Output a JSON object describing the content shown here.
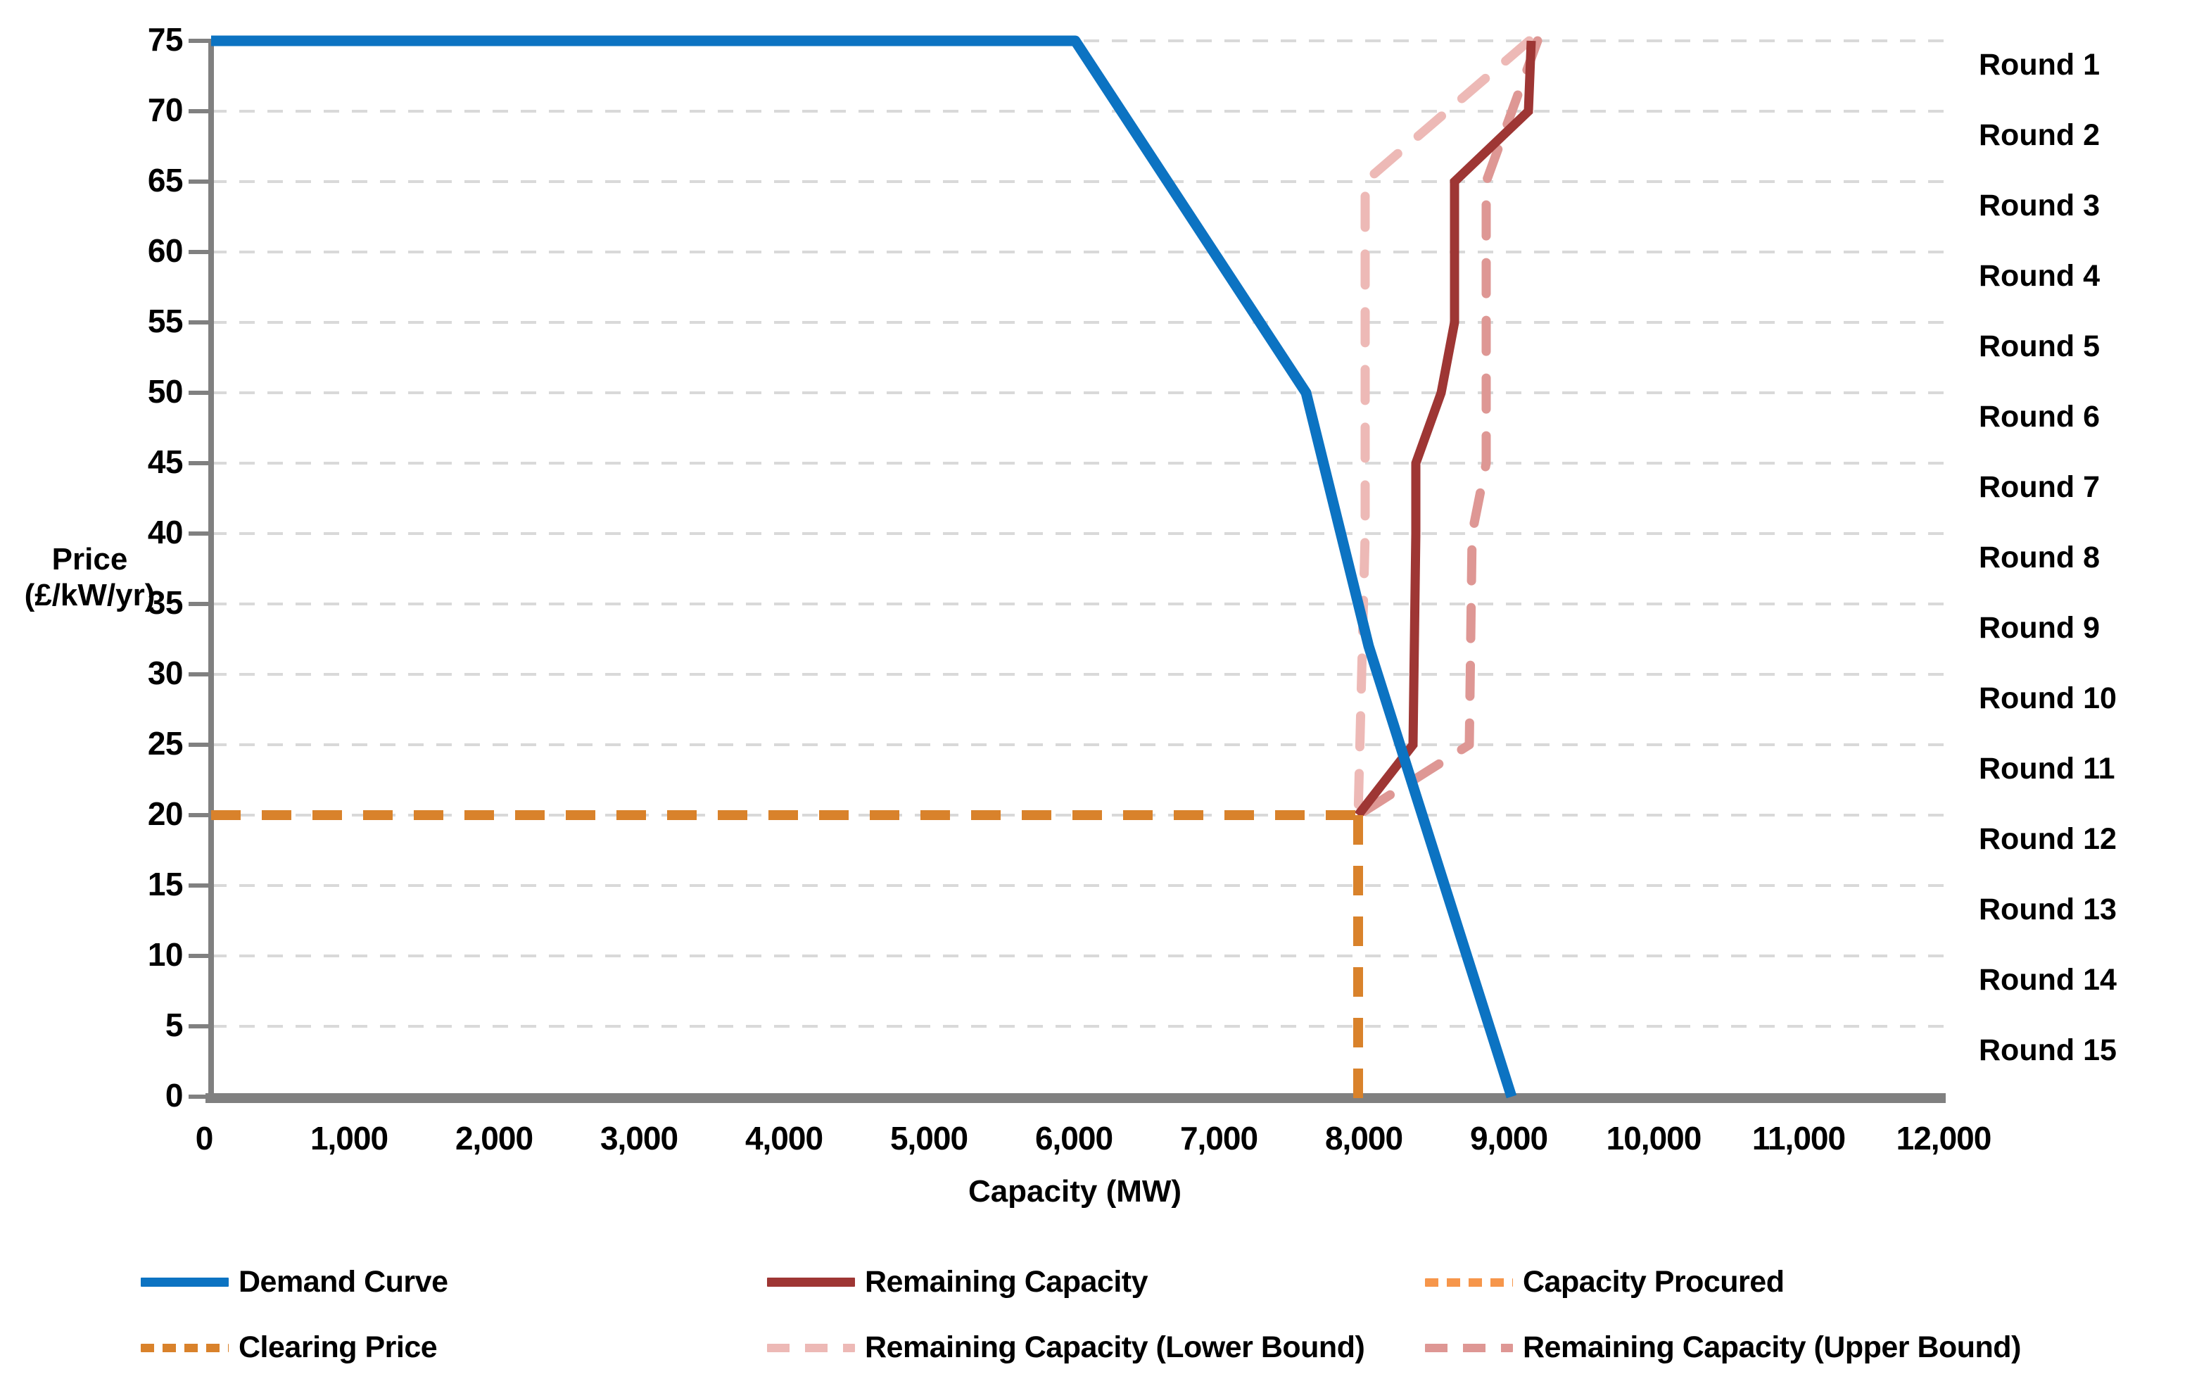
{
  "axes": {
    "y_title": "Price\n(£/kW/yr)",
    "y_title_line1": "Price",
    "y_title_line2": "(£/kW/yr)",
    "x_title": "Capacity (MW)",
    "y_ticks": [
      "0",
      "5",
      "10",
      "15",
      "20",
      "25",
      "30",
      "35",
      "40",
      "45",
      "50",
      "55",
      "60",
      "65",
      "70",
      "75"
    ],
    "x_ticks": [
      "0",
      "1,000",
      "2,000",
      "3,000",
      "4,000",
      "5,000",
      "6,000",
      "7,000",
      "8,000",
      "9,000",
      "10,000",
      "11,000",
      "12,000"
    ]
  },
  "rounds": [
    {
      "label": "Round 1"
    },
    {
      "label": "Round 2"
    },
    {
      "label": "Round 3"
    },
    {
      "label": "Round 4"
    },
    {
      "label": "Round 5"
    },
    {
      "label": "Round 6"
    },
    {
      "label": "Round 7"
    },
    {
      "label": "Round 8"
    },
    {
      "label": "Round 9"
    },
    {
      "label": "Round 10"
    },
    {
      "label": "Round 11"
    },
    {
      "label": "Round 12"
    },
    {
      "label": "Round 13"
    },
    {
      "label": "Round 14"
    },
    {
      "label": "Round 15"
    }
  ],
  "legend": [
    {
      "label": "Demand Curve",
      "color": "#0C73C2",
      "style": "solid"
    },
    {
      "label": "Remaining Capacity",
      "color": "#9E3634",
      "style": "solid"
    },
    {
      "label": "Capacity Procured",
      "color": "#F6964B",
      "style": "dotted"
    },
    {
      "label": "Clearing Price",
      "color": "#D9822B",
      "style": "dotted"
    },
    {
      "label": "Remaining Capacity (Lower Bound)",
      "color": "#EDB9B6",
      "style": "dashed"
    },
    {
      "label": "Remaining Capacity (Upper Bound)",
      "color": "#DE9794",
      "style": "dashed"
    }
  ],
  "colors": {
    "demand": "#0C73C2",
    "remaining": "#9E3634",
    "procured": "#F6964B",
    "clearing": "#D9822B",
    "lower_bound": "#EDB9B6",
    "upper_bound": "#DE9794",
    "axis": "#808080",
    "grid": "#D9D9D9"
  },
  "chart_data": {
    "type": "line",
    "title": "",
    "xlabel": "Capacity (MW)",
    "ylabel": "Price (£/kW/yr)",
    "xlim": [
      0,
      12000
    ],
    "ylim": [
      0,
      75
    ],
    "xticks": [
      0,
      1000,
      2000,
      3000,
      4000,
      5000,
      6000,
      7000,
      8000,
      9000,
      10000,
      11000,
      12000
    ],
    "yticks": [
      0,
      5,
      10,
      15,
      20,
      25,
      30,
      35,
      40,
      45,
      50,
      55,
      60,
      65,
      70,
      75
    ],
    "grid": "horizontal-dashed",
    "legend_position": "bottom",
    "series": [
      {
        "name": "Demand Curve",
        "color": "#0C73C2",
        "style": "solid",
        "points": [
          [
            0,
            75
          ],
          [
            6000,
            75
          ],
          [
            7550,
            50
          ],
          [
            8000,
            32
          ],
          [
            9000,
            0
          ]
        ]
      },
      {
        "name": "Remaining Capacity",
        "color": "#9E3634",
        "style": "solid",
        "points": [
          [
            9100,
            75
          ],
          [
            9080,
            70
          ],
          [
            8570,
            65
          ],
          [
            8570,
            55
          ],
          [
            8480,
            50
          ],
          [
            8300,
            45
          ],
          [
            8300,
            40
          ],
          [
            8280,
            25
          ],
          [
            7950,
            20
          ]
        ]
      },
      {
        "name": "Remaining Capacity (Lower Bound)",
        "color": "#EDB9B6",
        "style": "dashed",
        "points": [
          [
            9080,
            75
          ],
          [
            8000,
            65
          ],
          [
            8000,
            40
          ],
          [
            7950,
            20
          ]
        ]
      },
      {
        "name": "Remaining Capacity (Upper Bound)",
        "color": "#DE9794",
        "style": "dashed",
        "points": [
          [
            9140,
            75
          ],
          [
            8800,
            65
          ],
          [
            8800,
            45
          ],
          [
            8700,
            40
          ],
          [
            8680,
            25
          ],
          [
            7950,
            20
          ]
        ]
      },
      {
        "name": "Clearing Price",
        "color": "#D9822B",
        "style": "dotted",
        "points": [
          [
            0,
            20
          ],
          [
            7950,
            20
          ]
        ]
      },
      {
        "name": "Capacity Procured",
        "color": "#F6964B",
        "style": "dotted",
        "points": [
          [
            7950,
            20
          ],
          [
            7950,
            0
          ]
        ]
      }
    ],
    "annotations": [
      "Round 1",
      "Round 2",
      "Round 3",
      "Round 4",
      "Round 5",
      "Round 6",
      "Round 7",
      "Round 8",
      "Round 9",
      "Round 10",
      "Round 11",
      "Round 12",
      "Round 13",
      "Round 14",
      "Round 15"
    ]
  }
}
